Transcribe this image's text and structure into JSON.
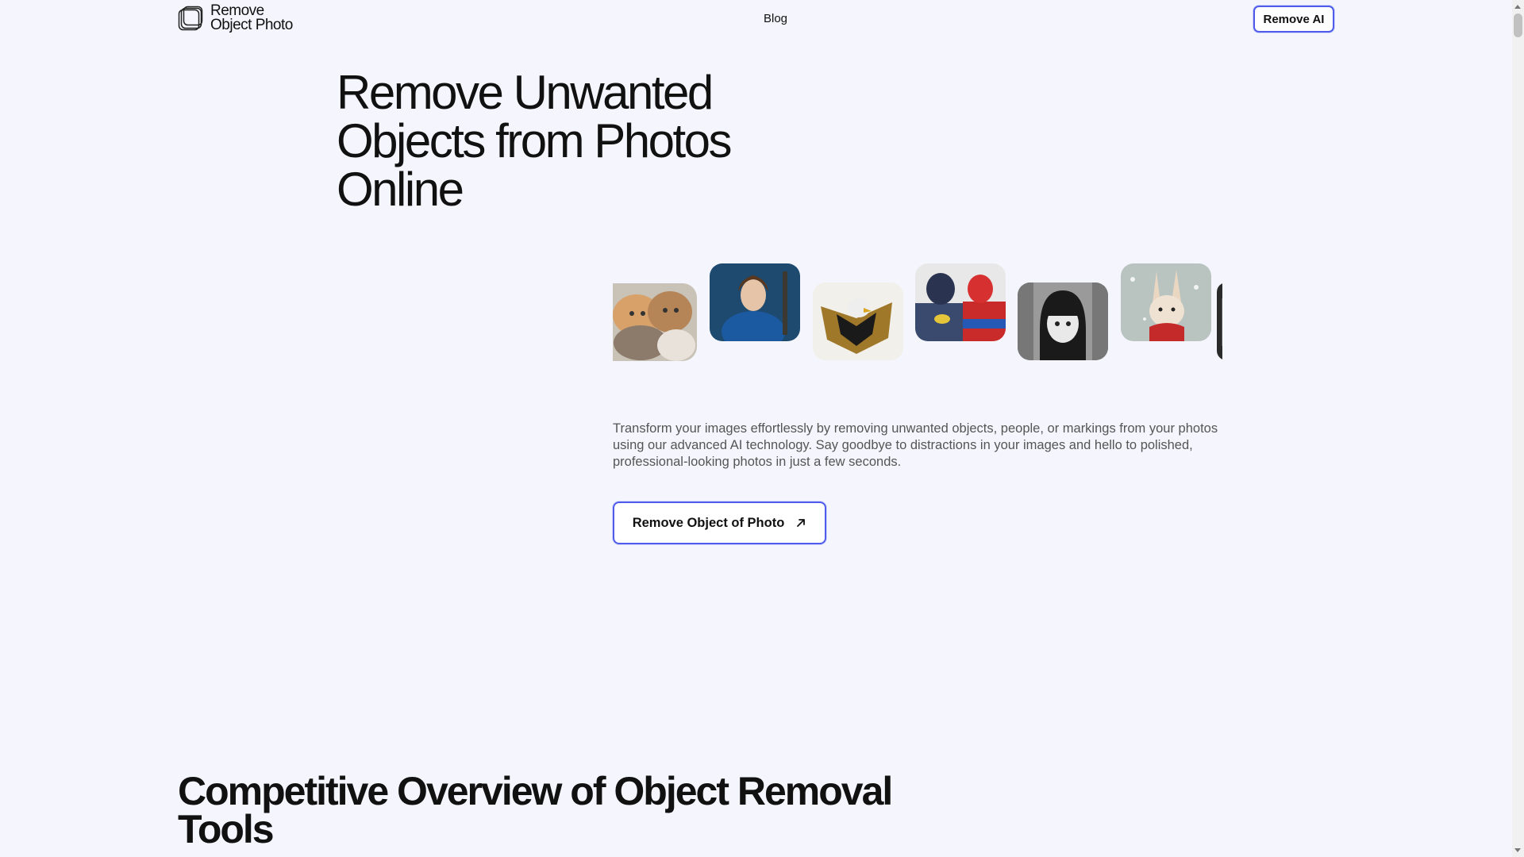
{
  "header": {
    "logo_line1": "Remove",
    "logo_line2": "Object Photo",
    "nav_blog": "Blog",
    "remove_ai": "Remove AI"
  },
  "hero": {
    "title_line1": "Remove Unwanted",
    "title_line2": "Objects from Photos",
    "title_line3": "Online",
    "description": "Transform your images effortlessly by removing unwanted objects, people, or markings from your photos using our advanced AI technology. Say goodbye to distractions in your images and hello to polished, professional-looking photos in just a few seconds.",
    "cta_label": "Remove Object of Photo"
  },
  "gallery": {
    "tiles": [
      "cats-photo",
      "woman-portrait-photo",
      "eagle-photo",
      "batman-spiderman-photo",
      "anime-girl-photo",
      "rabbit-photo",
      "partial-photo"
    ]
  },
  "section": {
    "title_line1": "Competitive Overview of Object Removal",
    "title_line2": "Tools"
  },
  "colors": {
    "accent": "#4f5bea",
    "background": "#f5f6fd"
  }
}
